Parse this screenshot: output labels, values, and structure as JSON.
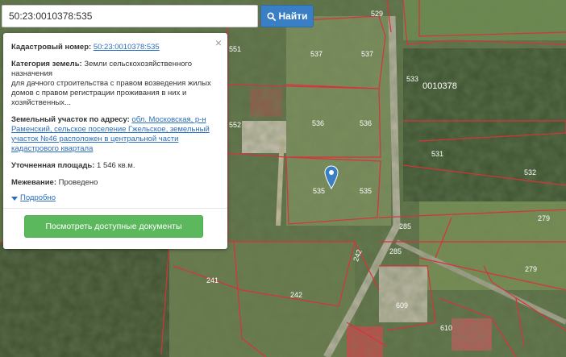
{
  "search": {
    "value": "50:23:0010378:535",
    "button_label": "Найти"
  },
  "popup": {
    "cadastral_label": "Кадастровый номер:",
    "cadastral_number": "50:23:0010378:535",
    "category_label": "Категория земель:",
    "category_value": "Земли сельскохозяйственного назначения",
    "category_detail": "для дачного строительства с правом возведения жилых домов с правом регистрации проживания в них и хозяйственных...",
    "address_label": "Земельный участок по адресу:",
    "address_value": "обл. Московская, р-н Раменский, сельское поселение Гжельское, земельный участок №46 расположен в центральной части кадастрового квартала",
    "area_label": "Уточненная площадь:",
    "area_value": "1 546 кв.м.",
    "survey_label": "Межевание:",
    "survey_value": "Проведено",
    "more_label": "Подробно",
    "docs_button": "Посмотреть доступные документы",
    "close": "×"
  },
  "map": {
    "quarter": "0010378",
    "parcels": [
      "529",
      "537",
      "537",
      "533",
      "536",
      "536",
      "531",
      "535",
      "535",
      "532",
      "279",
      "285",
      "285",
      "279",
      "242",
      "241",
      "242",
      "609",
      "610",
      "551",
      "552"
    ]
  },
  "colors": {
    "search_button": "#3a7fc4",
    "docs_button": "#5cb85c",
    "link": "#2a6ebb",
    "boundary": "#d8323c",
    "pin": "#3a7fc4"
  }
}
